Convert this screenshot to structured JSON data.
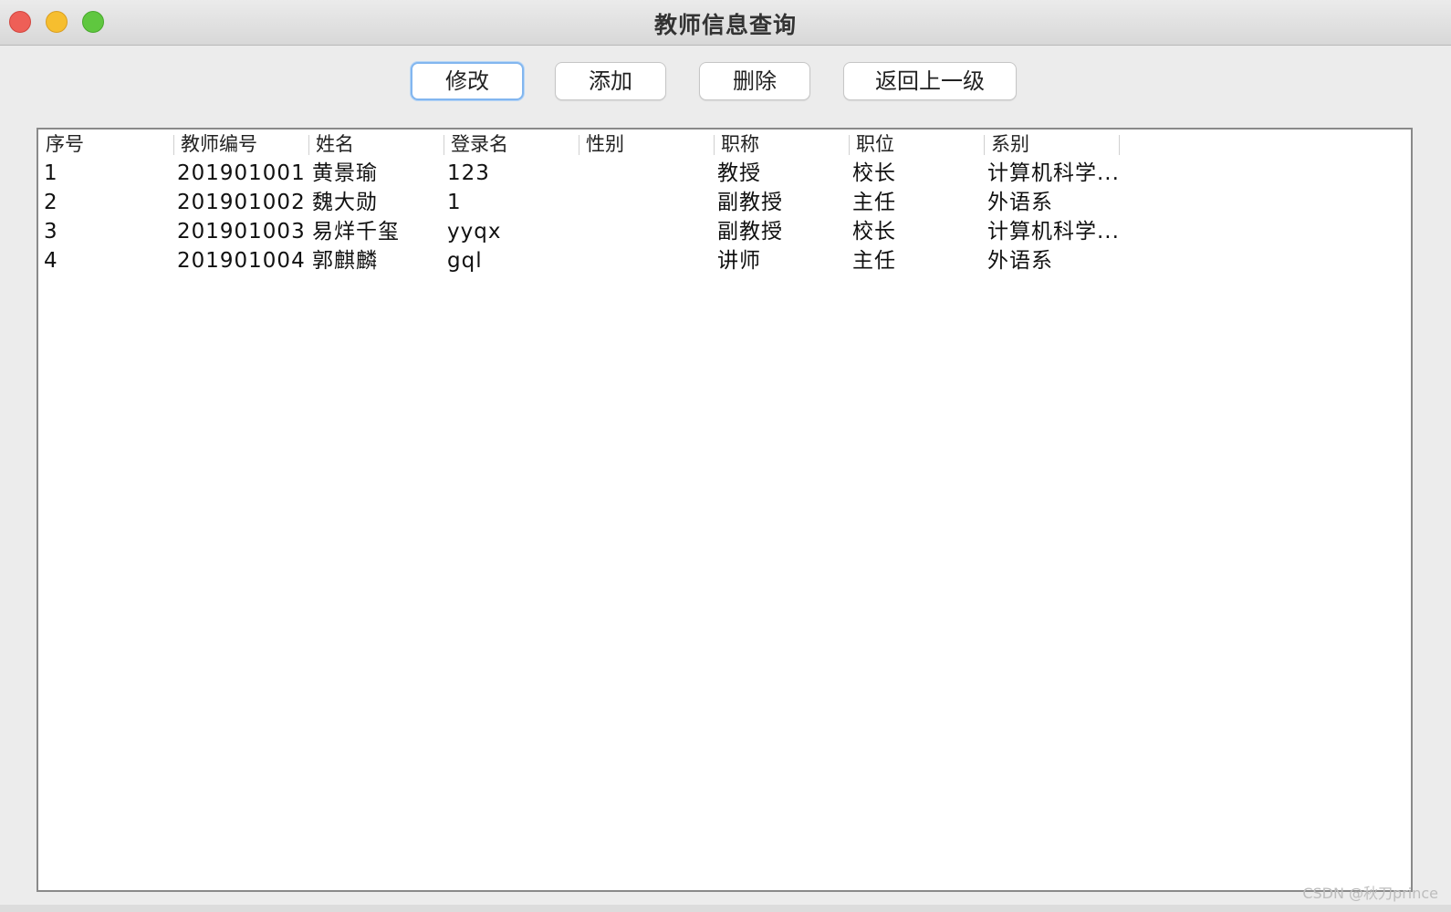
{
  "window": {
    "title": "教师信息查询"
  },
  "toolbar": {
    "modify_label": "修改",
    "add_label": "添加",
    "delete_label": "删除",
    "back_label": "返回上一级"
  },
  "table": {
    "columns": [
      "序号",
      "教师编号",
      "姓名",
      "登录名",
      "性别",
      "职称",
      "职位",
      "系别"
    ],
    "rows": [
      [
        "1",
        "201901001",
        "黄景瑜",
        "123",
        "",
        "教授",
        "校长",
        "计算机科学..."
      ],
      [
        "2",
        "201901002",
        "魏大勋",
        "1",
        "",
        "副教授",
        "主任",
        "外语系"
      ],
      [
        "3",
        "201901003",
        "易烊千玺",
        "yyqx",
        "",
        "副教授",
        "校长",
        "计算机科学..."
      ],
      [
        "4",
        "201901004",
        "郭麒麟",
        "gql",
        "",
        "讲师",
        "主任",
        "外语系"
      ]
    ]
  },
  "watermark": "CSDN @秋刀prince"
}
